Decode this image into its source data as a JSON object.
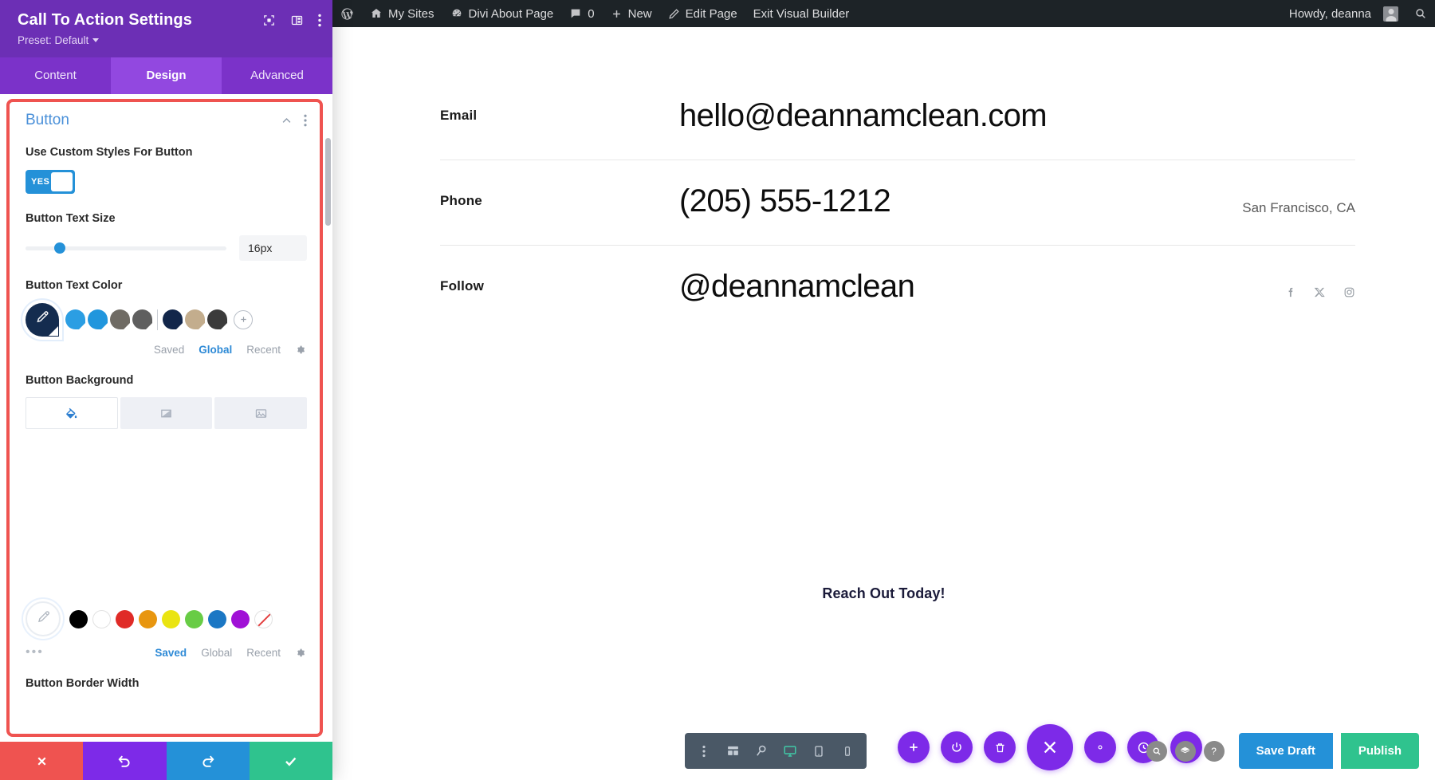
{
  "adminbar": {
    "items": [
      {
        "icon": "wordpress-logo-icon",
        "label": ""
      },
      {
        "icon": "my-sites-icon",
        "label": "My Sites"
      },
      {
        "icon": "dashboard-icon",
        "label": "Divi About Page"
      },
      {
        "icon": "comment-icon",
        "label": "0"
      },
      {
        "icon": "plus-icon",
        "label": "New"
      },
      {
        "icon": "pencil-icon",
        "label": "Edit Page"
      },
      {
        "icon": "",
        "label": "Exit Visual Builder"
      }
    ],
    "howdy": "Howdy, deanna",
    "search_icon": "search-icon"
  },
  "canvas": {
    "rows": [
      {
        "label": "Email",
        "value": "hello@deannamclean.com",
        "extra": ""
      },
      {
        "label": "Phone",
        "value": "(205) 555-1212",
        "extra": "San Francisco, CA"
      },
      {
        "label": "Follow",
        "value": "@deannamclean",
        "extra": ""
      }
    ],
    "social": [
      "facebook-icon",
      "x-twitter-icon",
      "instagram-icon"
    ],
    "cta_text": "Reach Out Today!"
  },
  "builder_bar": {
    "view_modes": [
      {
        "name": "more-options-icon",
        "active": false
      },
      {
        "name": "wireframe-icon",
        "active": false
      },
      {
        "name": "zoom-out-icon",
        "active": false
      },
      {
        "name": "desktop-icon",
        "active": true
      },
      {
        "name": "tablet-icon",
        "active": false
      },
      {
        "name": "phone-icon",
        "active": false
      }
    ],
    "round_tools": [
      {
        "name": "add-module-icon"
      },
      {
        "name": "power-toggle-icon"
      },
      {
        "name": "trash-icon"
      },
      {
        "name": "close-builder-icon"
      },
      {
        "name": "settings-gear-icon"
      },
      {
        "name": "history-clock-icon"
      },
      {
        "name": "portability-icon"
      }
    ],
    "helpers": [
      "search-icon",
      "layers-icon",
      "help-icon"
    ],
    "save_draft_label": "Save Draft",
    "publish_label": "Publish"
  },
  "settings": {
    "title": "Call To Action Settings",
    "preset_label": "Preset: Default",
    "header_icons": [
      "responsive-preview-icon",
      "layout-columns-icon",
      "kebab-menu-icon"
    ],
    "tabs": [
      {
        "label": "Content",
        "active": false
      },
      {
        "label": "Design",
        "active": true
      },
      {
        "label": "Advanced",
        "active": false
      }
    ],
    "section": {
      "title": "Button",
      "collapse_icon": "chevron-up-icon",
      "menu_icon": "kebab-menu-icon"
    },
    "custom_styles": {
      "label": "Use Custom Styles For Button",
      "toggle_value": "YES"
    },
    "text_size": {
      "label": "Button Text Size",
      "value": "16px",
      "slider_percent": 17
    },
    "text_color": {
      "label": "Button Text Color",
      "selected": "#142c4f",
      "swatches": [
        "#2b9ee3",
        "#2196dd",
        "#6f6b64",
        "#5f5f5f",
        "#12264a",
        "#c3ad8d",
        "#3b3b3b"
      ],
      "add_icon": "plus-icon",
      "tabs": [
        {
          "label": "Saved",
          "active": false
        },
        {
          "label": "Global",
          "active": true
        },
        {
          "label": "Recent",
          "active": false
        }
      ],
      "gear_icon": "gear-icon"
    },
    "background": {
      "label": "Button Background",
      "modes": [
        {
          "name": "paint-bucket-icon",
          "active": true
        },
        {
          "name": "gradient-icon",
          "active": false
        },
        {
          "name": "image-icon",
          "active": false
        }
      ],
      "palette_selected_icon": "eyedropper-icon",
      "palette": [
        "#000000",
        "#ffffff",
        "#e02b27",
        "#e8960f",
        "#eae411",
        "#68cc45",
        "#1b77c4",
        "#a011d6",
        "none"
      ],
      "more_icon": "ellipsis-icon",
      "tabs": [
        {
          "label": "Saved",
          "active": true
        },
        {
          "label": "Global",
          "active": false
        },
        {
          "label": "Recent",
          "active": false
        }
      ],
      "gear_icon": "gear-icon"
    },
    "border_width": {
      "label": "Button Border Width"
    },
    "footer": [
      {
        "name": "cancel-button",
        "icon": "close-icon"
      },
      {
        "name": "undo-button",
        "icon": "undo-icon"
      },
      {
        "name": "redo-button",
        "icon": "redo-icon"
      },
      {
        "name": "save-button",
        "icon": "check-icon"
      }
    ]
  }
}
